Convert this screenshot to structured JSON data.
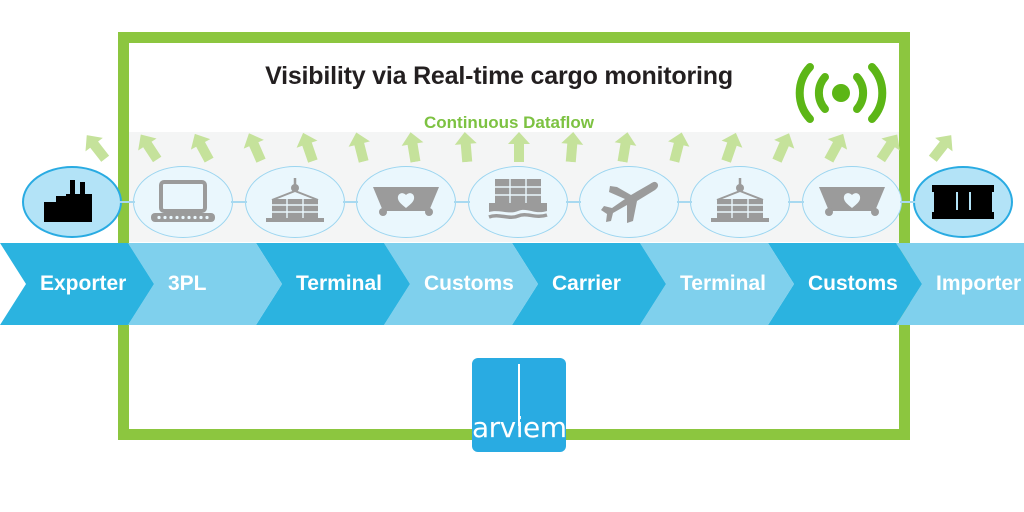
{
  "headline": {
    "title": "Visibility via Real-time cargo monitoring",
    "subtitle": "Continuous Dataflow",
    "signal_icon": "broadcast-signal-icon"
  },
  "colors": {
    "frame_green": "#8CC63F",
    "arrow_green": "#C5E29B",
    "subtitle_green": "#7DC242",
    "signal_green": "#5CB616",
    "chevron_dark": "#2BB3E0",
    "chevron_light": "#7FD0ED",
    "logo_blue": "#29ABE2",
    "endpoint_fill": "#b3e3f7",
    "endpoint_border": "#29ABE2",
    "node_fill": "#eaf7fd",
    "node_border": "#9BD5F0",
    "icon_grey": "#9B9B9B",
    "icon_black": "#000000",
    "title_black": "#231f20"
  },
  "nodes": [
    {
      "icon": "factory-icon",
      "endpoint": true
    },
    {
      "icon": "laptop-icon",
      "endpoint": false
    },
    {
      "icon": "container-crane-icon",
      "endpoint": false
    },
    {
      "icon": "customs-stamp-icon",
      "endpoint": false
    },
    {
      "icon": "container-ship-icon",
      "endpoint": false
    },
    {
      "icon": "airplane-icon",
      "endpoint": false
    },
    {
      "icon": "container-crane-icon",
      "endpoint": false
    },
    {
      "icon": "customs-stamp-icon",
      "endpoint": false
    },
    {
      "icon": "warehouse-icon",
      "endpoint": true
    }
  ],
  "process_steps": [
    {
      "label": "Exporter",
      "tone": "dark"
    },
    {
      "label": "3PL",
      "tone": "light"
    },
    {
      "label": "Terminal",
      "tone": "dark"
    },
    {
      "label": "Customs",
      "tone": "light"
    },
    {
      "label": "Carrier",
      "tone": "dark"
    },
    {
      "label": "Terminal",
      "tone": "light"
    },
    {
      "label": "Customs",
      "tone": "dark"
    },
    {
      "label": "Importer",
      "tone": "light"
    }
  ],
  "dataflow_arrows": {
    "count": 17,
    "description": "upward fanned arrows indicating continuous data flow"
  },
  "logo": {
    "name": "arviem",
    "wordmark": "arviem"
  }
}
